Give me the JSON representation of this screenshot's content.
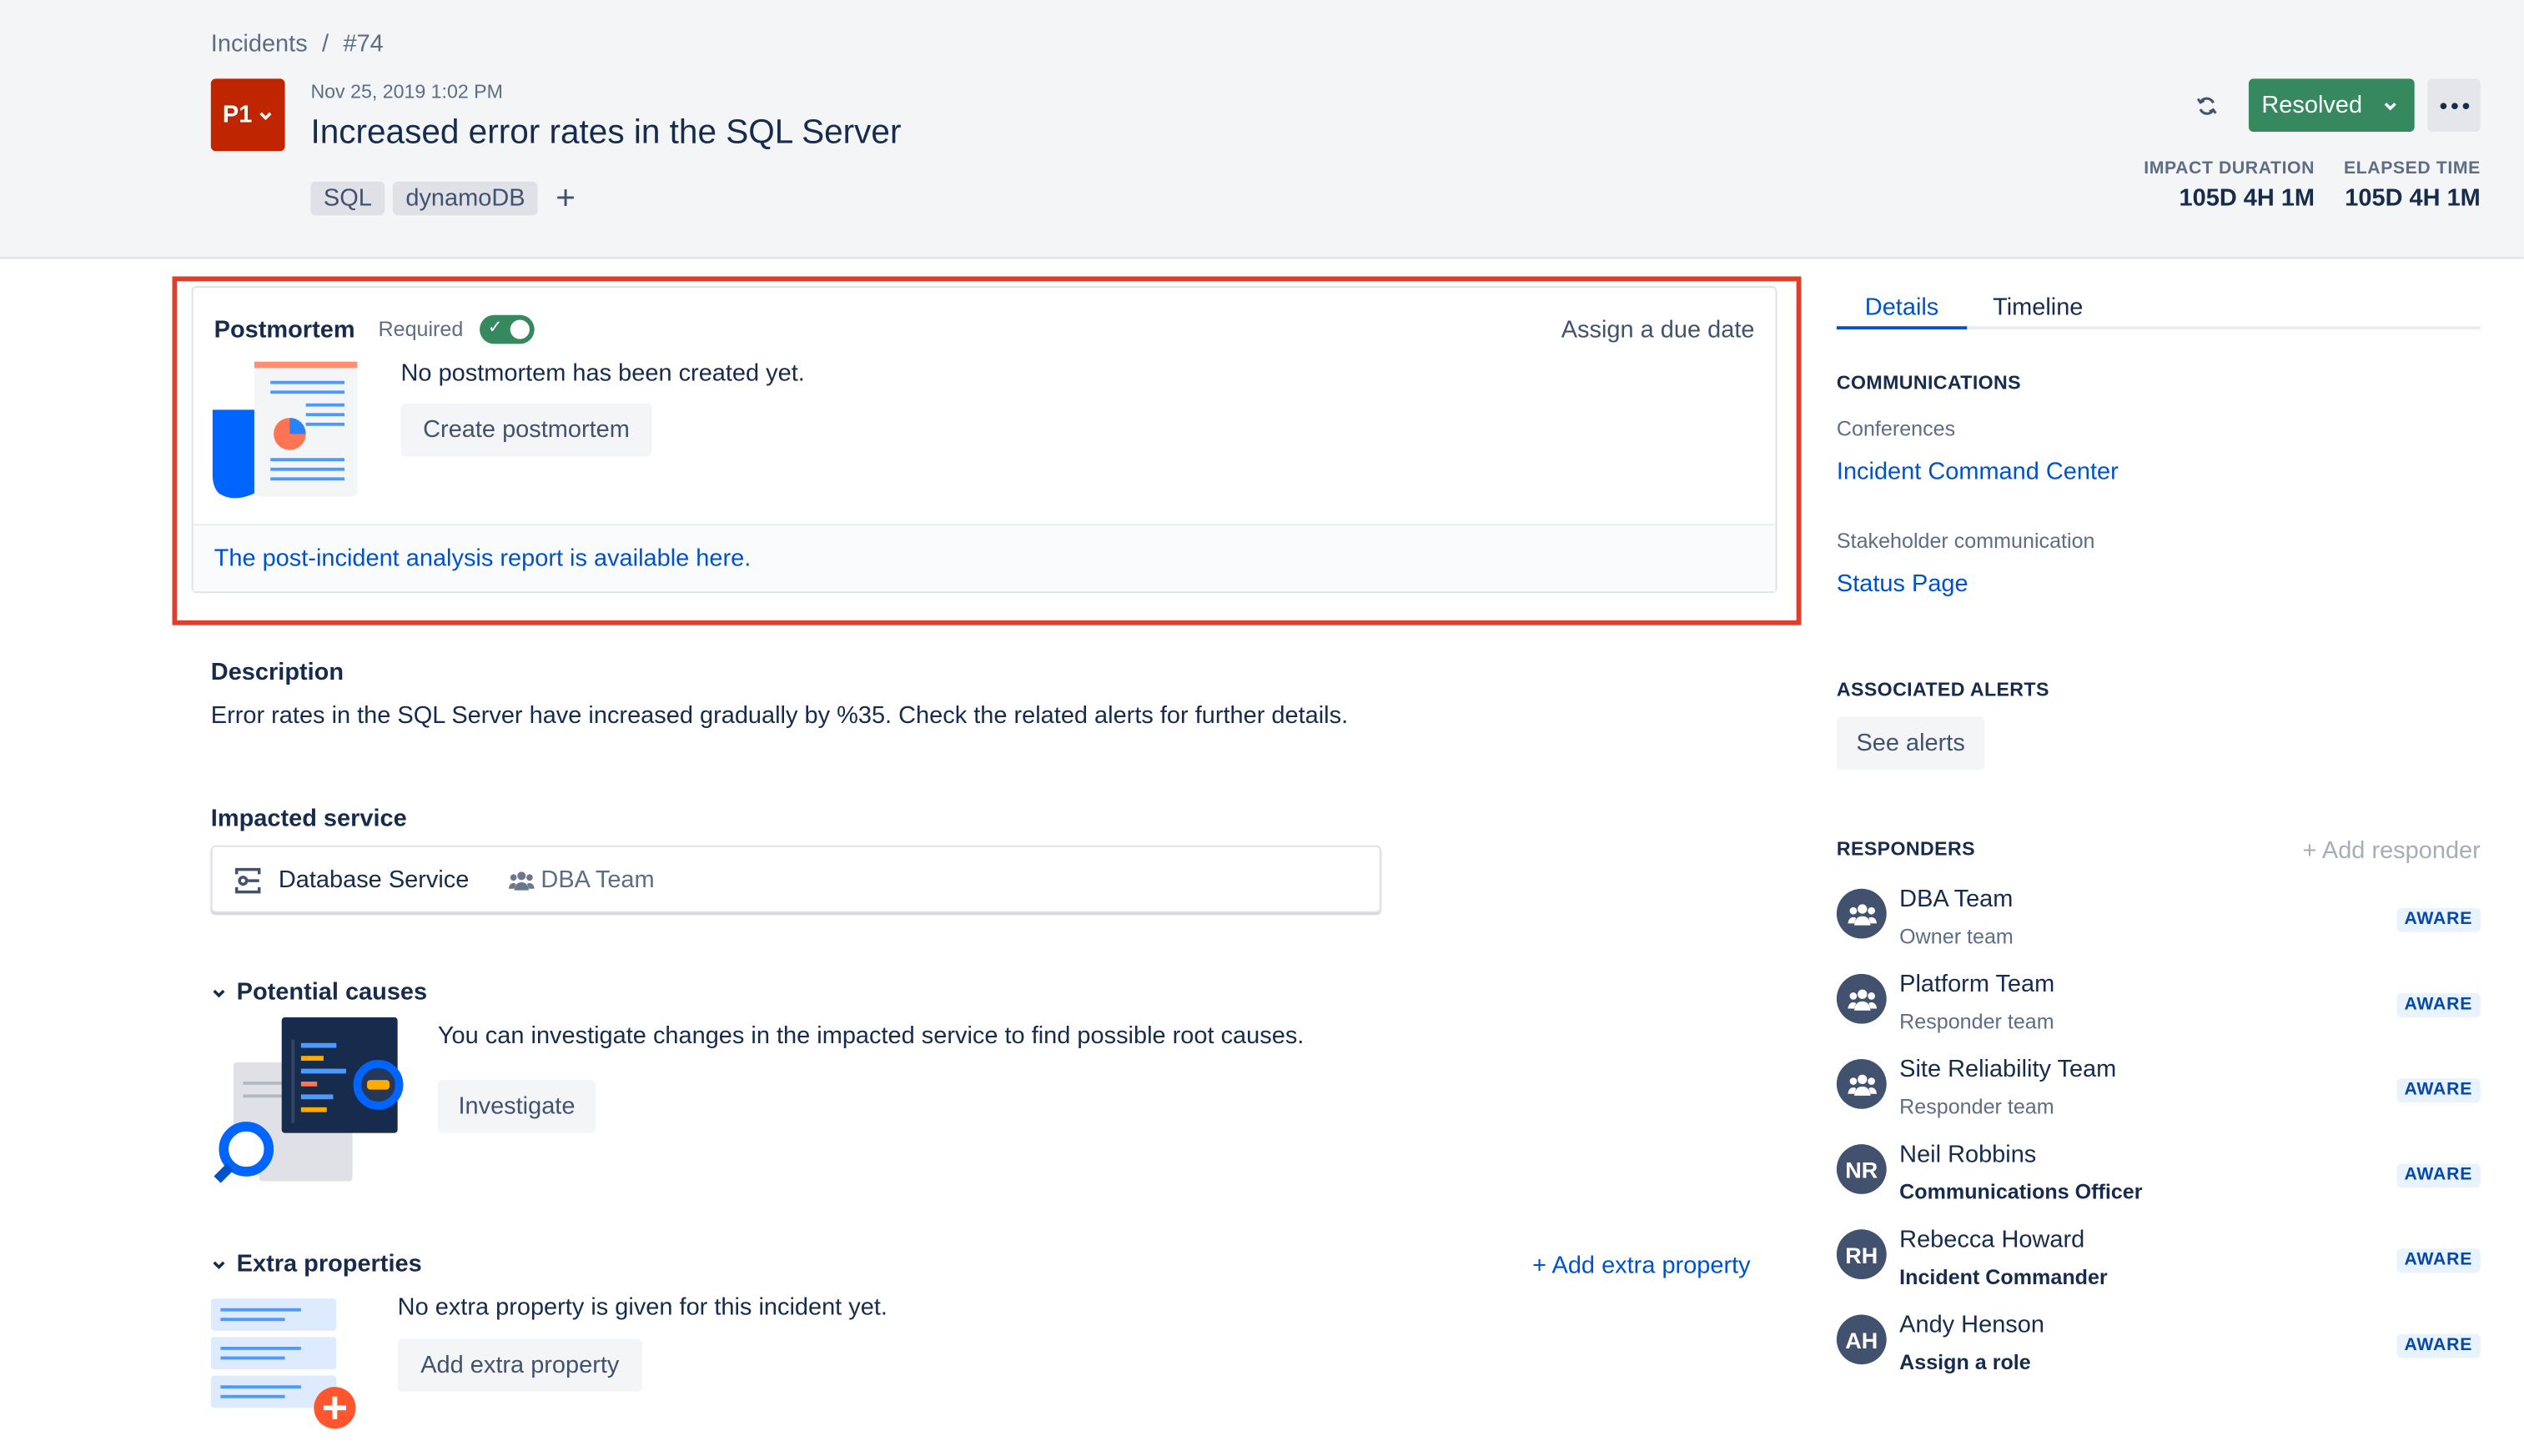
{
  "breadcrumb": {
    "parent": "Incidents",
    "separator": "/",
    "current": "#74"
  },
  "incident": {
    "priority": "P1",
    "created": "Nov 25, 2019 1:02 PM",
    "title": "Increased error rates in the SQL Server",
    "tags": [
      "SQL",
      "dynamoDB"
    ],
    "tag_add": "+",
    "status": "Resolved",
    "metrics": {
      "impact_label": "IMPACT DURATION",
      "impact_value": "105D 4H 1M",
      "elapsed_label": "ELAPSED TIME",
      "elapsed_value": "105D 4H 1M"
    }
  },
  "postmortem": {
    "title": "Postmortem",
    "required_label": "Required",
    "required": true,
    "due_date": "Assign a due date",
    "message": "No postmortem has been created yet.",
    "create_button": "Create postmortem",
    "report_link": "The post-incident analysis report is available here."
  },
  "description": {
    "title": "Description",
    "text": "Error rates in the SQL Server have increased gradually by %35. Check the related alerts for further details."
  },
  "impacted_service": {
    "title": "Impacted service",
    "service": "Database Service",
    "team": "DBA Team"
  },
  "potential_causes": {
    "title": "Potential causes",
    "text": "You can investigate changes in the impacted service to find possible root causes.",
    "button": "Investigate"
  },
  "extra_properties": {
    "title": "Extra properties",
    "add_link": "+ Add extra property",
    "text": "No extra property is given for this incident yet.",
    "button": "Add extra property"
  },
  "sidebar": {
    "tabs": [
      "Details",
      "Timeline"
    ],
    "communications": {
      "title": "COMMUNICATIONS",
      "conferences_label": "Conferences",
      "conferences_link": "Incident Command Center",
      "stakeholder_label": "Stakeholder communication",
      "stakeholder_link": "Status Page"
    },
    "alerts": {
      "title": "ASSOCIATED ALERTS",
      "button": "See alerts"
    },
    "responders": {
      "title": "RESPONDERS",
      "add": "+ Add responder",
      "items": [
        {
          "name": "DBA Team",
          "role": "Owner team",
          "status": "AWARE",
          "type": "team",
          "initials": ""
        },
        {
          "name": "Platform Team",
          "role": "Responder team",
          "status": "AWARE",
          "type": "team",
          "initials": ""
        },
        {
          "name": "Site Reliability Team",
          "role": "Responder team",
          "status": "AWARE",
          "type": "team",
          "initials": ""
        },
        {
          "name": "Neil Robbins",
          "role": "Communications Officer",
          "status": "AWARE",
          "type": "user",
          "initials": "NR"
        },
        {
          "name": "Rebecca Howard",
          "role": "Incident Commander",
          "status": "AWARE",
          "type": "user",
          "initials": "RH"
        },
        {
          "name": "Andy Henson",
          "role": "Assign a role",
          "status": "AWARE",
          "type": "user",
          "initials": "AH"
        }
      ]
    }
  },
  "colors": {
    "priority": "#bf2600",
    "resolved": "#36885f",
    "link": "#0052cc",
    "highlight": "#e03e2d",
    "header_bg": "#f4f5f7",
    "avatar": "#42526e"
  }
}
